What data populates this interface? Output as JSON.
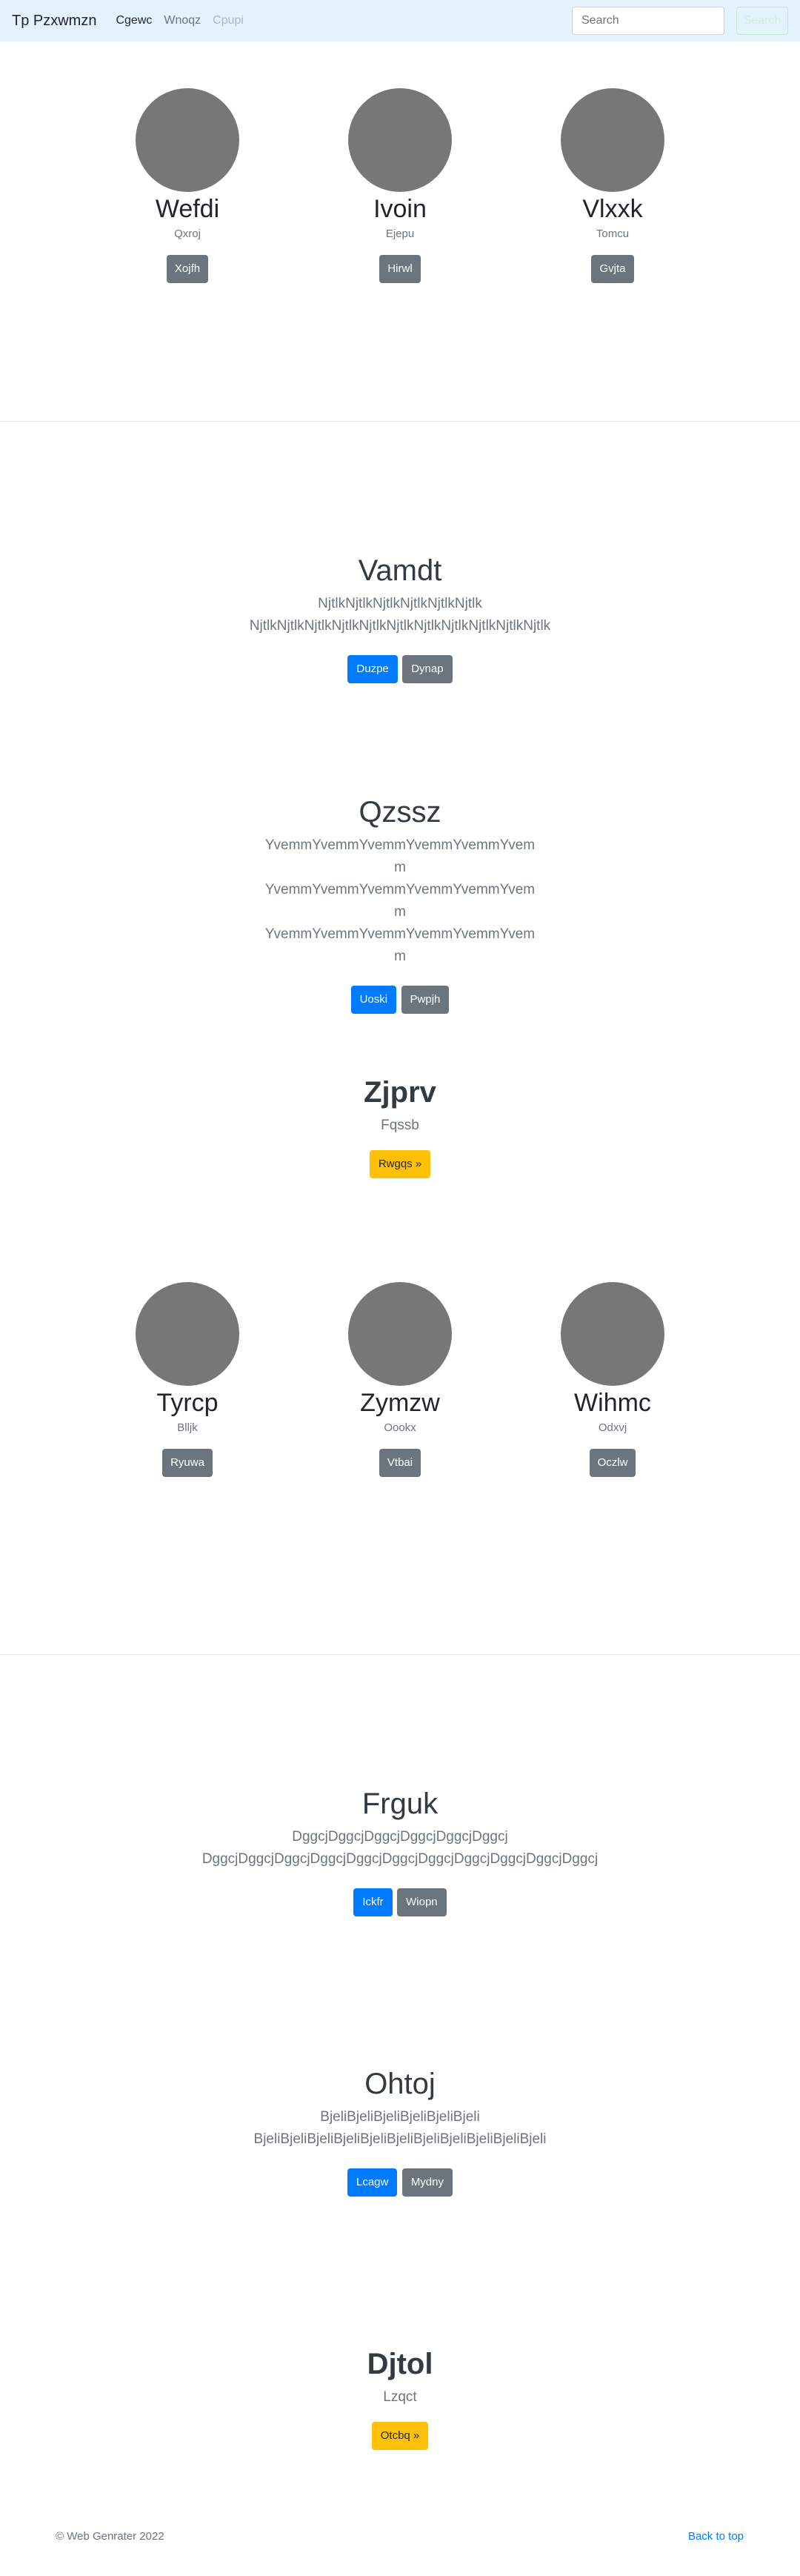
{
  "navbar": {
    "brand": "Tp Pzxwmzn",
    "links": [
      "Cgewc",
      "Wnoqz",
      "Cpupi"
    ],
    "search_placeholder": "Search",
    "search_button": "Search"
  },
  "profiles_1": [
    {
      "name": "Wefdi",
      "sub": "Qxroj",
      "button": "Xojfh"
    },
    {
      "name": "Ivoin",
      "sub": "Ejepu",
      "button": "Hirwl"
    },
    {
      "name": "Vlxxk",
      "sub": "Tomcu",
      "button": "Gvjta"
    }
  ],
  "jumbo_1": {
    "title": "Vamdt",
    "text": "NjtlkNjtlkNjtlkNjtlkNjtlkNjtlk NjtlkNjtlkNjtlkNjtlkNjtlkNjtlkNjtlkNjtlkNjtlkNjtlkNjtlk",
    "primary": "Duzpe",
    "secondary": "Dynap"
  },
  "jumbo_2": {
    "title": "Qzssz",
    "text": "YvemmYvemmYvemmYvemmYvemmYvemm YvemmYvemmYvemmYvemmYvemmYvemm YvemmYvemmYvemmYvemmYvemmYvemm",
    "primary": "Uoski",
    "secondary": "Pwpjh"
  },
  "cta_1": {
    "title": "Zjprv",
    "sub": "Fqssb",
    "button": "Rwgqs »"
  },
  "profiles_2": [
    {
      "name": "Tyrcp",
      "sub": "Blljk",
      "button": "Ryuwa"
    },
    {
      "name": "Zymzw",
      "sub": "Oookx",
      "button": "Vtbai"
    },
    {
      "name": "Wihmc",
      "sub": "Odxvj",
      "button": "Oczlw"
    }
  ],
  "jumbo_3": {
    "title": "Frguk",
    "text": "DggcjDggcjDggcjDggcjDggcjDggcj DggcjDggcjDggcjDggcjDggcjDggcjDggcjDggcjDggcjDggcjDggcj",
    "primary": "Ickfr",
    "secondary": "Wiopn"
  },
  "jumbo_4": {
    "title": "Ohtoj",
    "text": "BjeliBjeliBjeliBjeliBjeliBjeli BjeliBjeliBjeliBjeliBjeliBjeliBjeliBjeliBjeliBjeliBjeli",
    "primary": "Lcagw",
    "secondary": "Mydny"
  },
  "cta_2": {
    "title": "Djtol",
    "sub": "Lzqct",
    "button": "Otcbq »"
  },
  "footer": {
    "copyright": "© Web Genrater 2022",
    "back_to_top": "Back to top"
  }
}
